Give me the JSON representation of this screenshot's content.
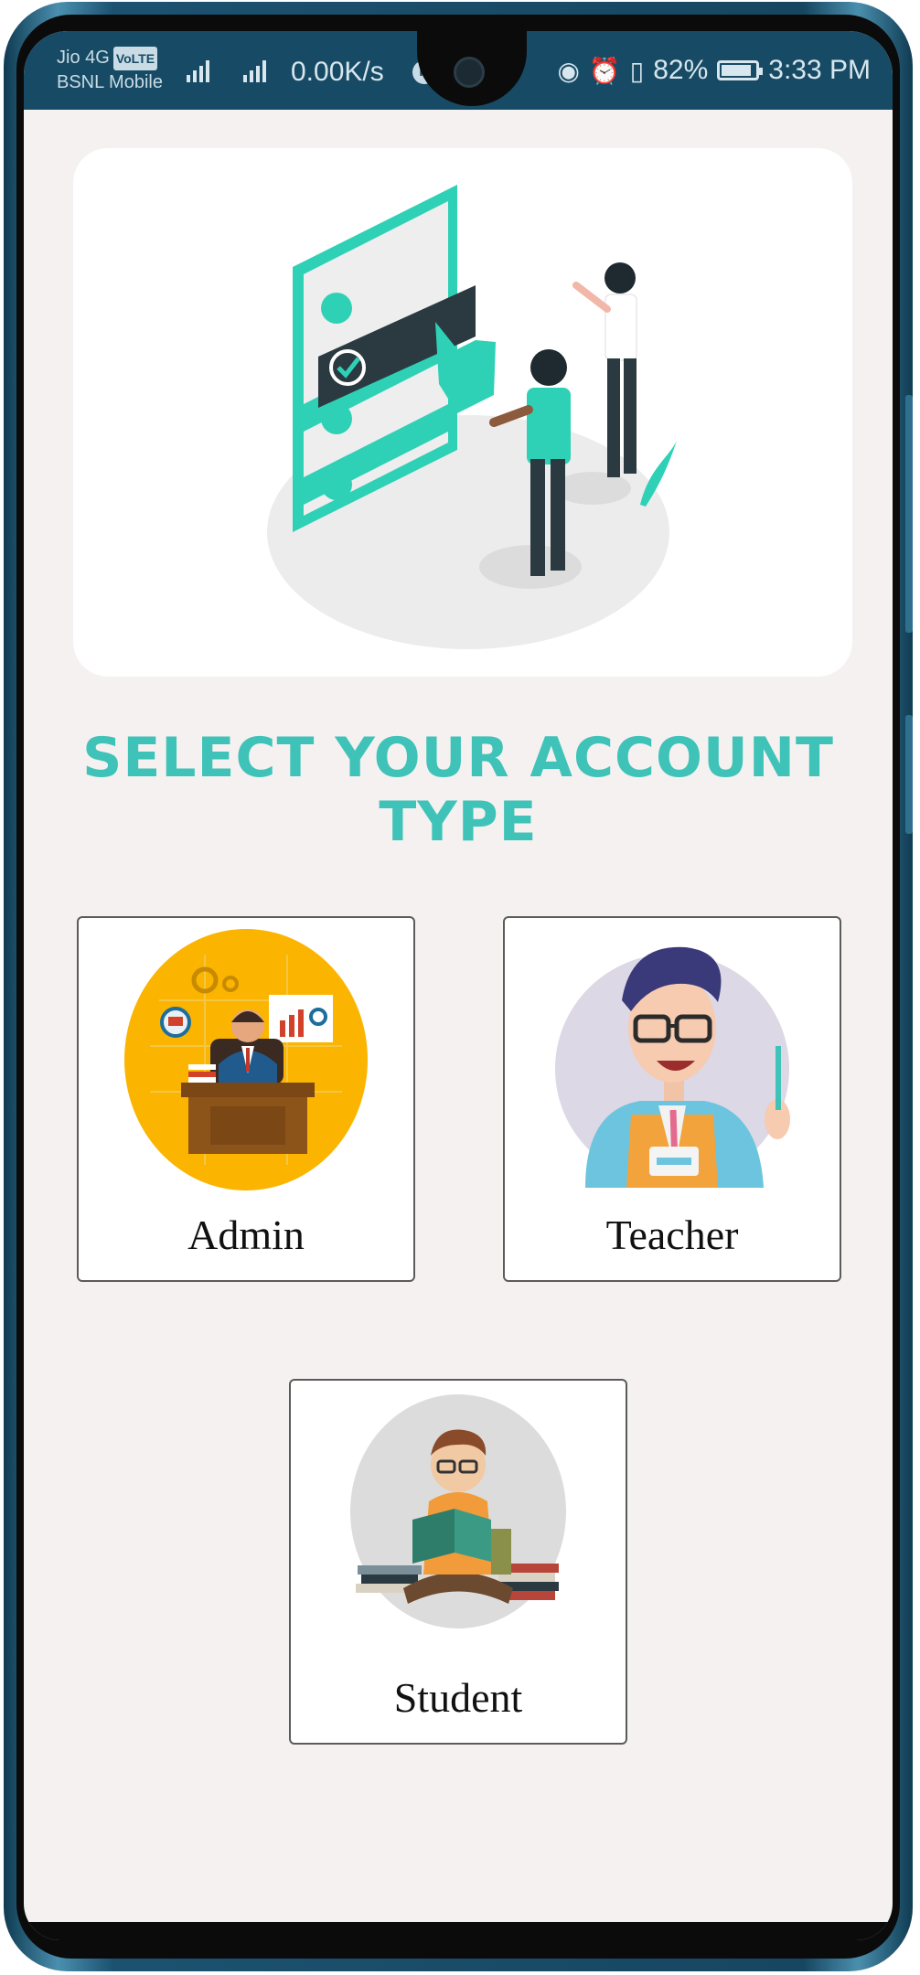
{
  "status_bar": {
    "carrier_1": "Jio 4G",
    "volte": "VoLTE",
    "carrier_2": "BSNL Mobile",
    "network_speed": "0.00K/s",
    "battery": "82%",
    "time": "3:33 PM"
  },
  "page": {
    "title": "Select your account type"
  },
  "accounts": {
    "admin": {
      "label": "Admin"
    },
    "teacher": {
      "label": "Teacher"
    },
    "student": {
      "label": "Student"
    }
  },
  "colors": {
    "accent": "#3fc3b8",
    "status_bar": "#174b65",
    "background": "#f4f1f0"
  }
}
